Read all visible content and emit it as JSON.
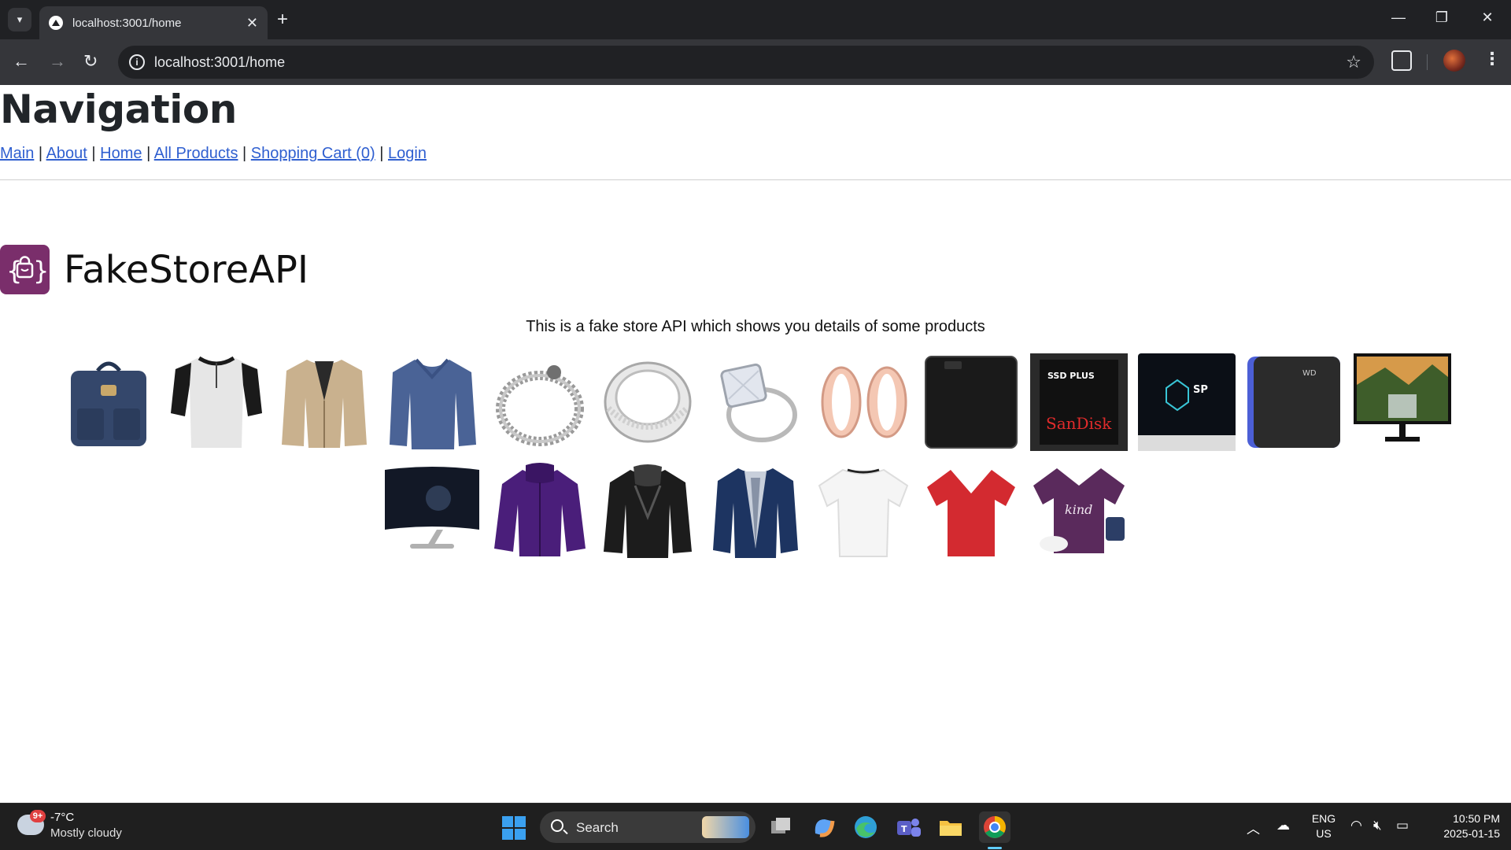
{
  "browser": {
    "tab_title": "localhost:3001/home",
    "url": "localhost:3001/home"
  },
  "page": {
    "nav_heading": "Navigation",
    "nav_links": [
      "Main",
      "About",
      "Home",
      "All Products",
      "Shopping Cart (0)",
      "Login"
    ],
    "separator": "|",
    "brand_title": "FakeStoreAPI",
    "subtitle": "This is a fake store API which shows you details of some products",
    "products_row1": [
      "backpack",
      "henley-shirt",
      "cotton-jacket",
      "slim-fit-shirt",
      "dragon-bracelet",
      "silver-ring",
      "princess-ring",
      "gold-earrings",
      "external-hard-drive",
      "sandisk-ssd",
      "silicon-power-ssd",
      "wd-gaming-drive",
      "acer-monitor"
    ],
    "products_row2": [
      "samsung-curved-monitor",
      "purple-snowboard-jacket",
      "leather-moto-jacket",
      "rain-jacket",
      "white-boat-neck-tee",
      "red-v-neck-tee",
      "purple-be-kind-tee"
    ]
  },
  "taskbar": {
    "weather_badge": "9+",
    "weather_temp": "-7°C",
    "weather_desc": "Mostly cloudy",
    "search_label": "Search",
    "lang_top": "ENG",
    "lang_bottom": "US",
    "time": "10:50 PM",
    "date": "2025-01-15"
  },
  "colors": {
    "link": "#2f5fd0",
    "brand_logo": "#7a2e6b",
    "chrome_dark": "#202124",
    "chrome_toolbar": "#35363a"
  }
}
